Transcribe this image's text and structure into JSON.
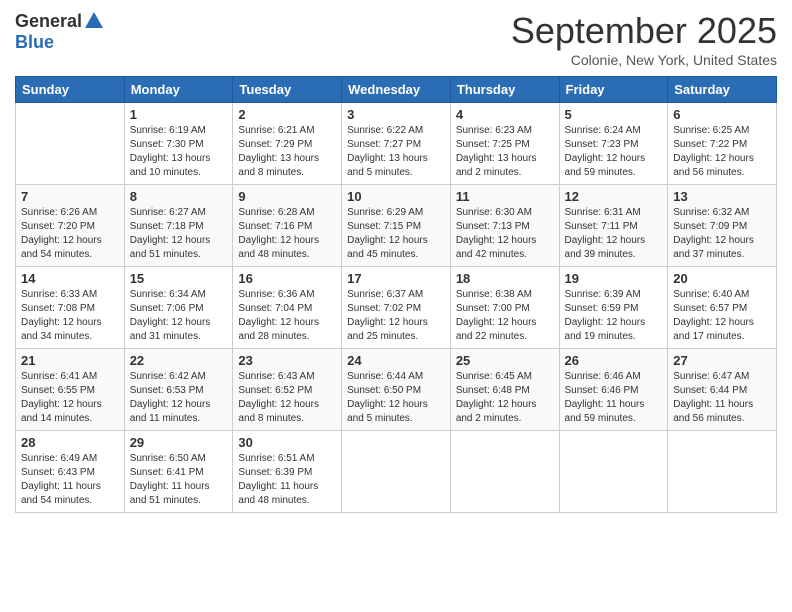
{
  "logo": {
    "general": "General",
    "blue": "Blue"
  },
  "header": {
    "month": "September 2025",
    "location": "Colonie, New York, United States"
  },
  "weekdays": [
    "Sunday",
    "Monday",
    "Tuesday",
    "Wednesday",
    "Thursday",
    "Friday",
    "Saturday"
  ],
  "weeks": [
    [
      {
        "day": null,
        "sunrise": null,
        "sunset": null,
        "daylight": null
      },
      {
        "day": "1",
        "sunrise": "Sunrise: 6:19 AM",
        "sunset": "Sunset: 7:30 PM",
        "daylight": "Daylight: 13 hours and 10 minutes."
      },
      {
        "day": "2",
        "sunrise": "Sunrise: 6:21 AM",
        "sunset": "Sunset: 7:29 PM",
        "daylight": "Daylight: 13 hours and 8 minutes."
      },
      {
        "day": "3",
        "sunrise": "Sunrise: 6:22 AM",
        "sunset": "Sunset: 7:27 PM",
        "daylight": "Daylight: 13 hours and 5 minutes."
      },
      {
        "day": "4",
        "sunrise": "Sunrise: 6:23 AM",
        "sunset": "Sunset: 7:25 PM",
        "daylight": "Daylight: 13 hours and 2 minutes."
      },
      {
        "day": "5",
        "sunrise": "Sunrise: 6:24 AM",
        "sunset": "Sunset: 7:23 PM",
        "daylight": "Daylight: 12 hours and 59 minutes."
      },
      {
        "day": "6",
        "sunrise": "Sunrise: 6:25 AM",
        "sunset": "Sunset: 7:22 PM",
        "daylight": "Daylight: 12 hours and 56 minutes."
      }
    ],
    [
      {
        "day": "7",
        "sunrise": "Sunrise: 6:26 AM",
        "sunset": "Sunset: 7:20 PM",
        "daylight": "Daylight: 12 hours and 54 minutes."
      },
      {
        "day": "8",
        "sunrise": "Sunrise: 6:27 AM",
        "sunset": "Sunset: 7:18 PM",
        "daylight": "Daylight: 12 hours and 51 minutes."
      },
      {
        "day": "9",
        "sunrise": "Sunrise: 6:28 AM",
        "sunset": "Sunset: 7:16 PM",
        "daylight": "Daylight: 12 hours and 48 minutes."
      },
      {
        "day": "10",
        "sunrise": "Sunrise: 6:29 AM",
        "sunset": "Sunset: 7:15 PM",
        "daylight": "Daylight: 12 hours and 45 minutes."
      },
      {
        "day": "11",
        "sunrise": "Sunrise: 6:30 AM",
        "sunset": "Sunset: 7:13 PM",
        "daylight": "Daylight: 12 hours and 42 minutes."
      },
      {
        "day": "12",
        "sunrise": "Sunrise: 6:31 AM",
        "sunset": "Sunset: 7:11 PM",
        "daylight": "Daylight: 12 hours and 39 minutes."
      },
      {
        "day": "13",
        "sunrise": "Sunrise: 6:32 AM",
        "sunset": "Sunset: 7:09 PM",
        "daylight": "Daylight: 12 hours and 37 minutes."
      }
    ],
    [
      {
        "day": "14",
        "sunrise": "Sunrise: 6:33 AM",
        "sunset": "Sunset: 7:08 PM",
        "daylight": "Daylight: 12 hours and 34 minutes."
      },
      {
        "day": "15",
        "sunrise": "Sunrise: 6:34 AM",
        "sunset": "Sunset: 7:06 PM",
        "daylight": "Daylight: 12 hours and 31 minutes."
      },
      {
        "day": "16",
        "sunrise": "Sunrise: 6:36 AM",
        "sunset": "Sunset: 7:04 PM",
        "daylight": "Daylight: 12 hours and 28 minutes."
      },
      {
        "day": "17",
        "sunrise": "Sunrise: 6:37 AM",
        "sunset": "Sunset: 7:02 PM",
        "daylight": "Daylight: 12 hours and 25 minutes."
      },
      {
        "day": "18",
        "sunrise": "Sunrise: 6:38 AM",
        "sunset": "Sunset: 7:00 PM",
        "daylight": "Daylight: 12 hours and 22 minutes."
      },
      {
        "day": "19",
        "sunrise": "Sunrise: 6:39 AM",
        "sunset": "Sunset: 6:59 PM",
        "daylight": "Daylight: 12 hours and 19 minutes."
      },
      {
        "day": "20",
        "sunrise": "Sunrise: 6:40 AM",
        "sunset": "Sunset: 6:57 PM",
        "daylight": "Daylight: 12 hours and 17 minutes."
      }
    ],
    [
      {
        "day": "21",
        "sunrise": "Sunrise: 6:41 AM",
        "sunset": "Sunset: 6:55 PM",
        "daylight": "Daylight: 12 hours and 14 minutes."
      },
      {
        "day": "22",
        "sunrise": "Sunrise: 6:42 AM",
        "sunset": "Sunset: 6:53 PM",
        "daylight": "Daylight: 12 hours and 11 minutes."
      },
      {
        "day": "23",
        "sunrise": "Sunrise: 6:43 AM",
        "sunset": "Sunset: 6:52 PM",
        "daylight": "Daylight: 12 hours and 8 minutes."
      },
      {
        "day": "24",
        "sunrise": "Sunrise: 6:44 AM",
        "sunset": "Sunset: 6:50 PM",
        "daylight": "Daylight: 12 hours and 5 minutes."
      },
      {
        "day": "25",
        "sunrise": "Sunrise: 6:45 AM",
        "sunset": "Sunset: 6:48 PM",
        "daylight": "Daylight: 12 hours and 2 minutes."
      },
      {
        "day": "26",
        "sunrise": "Sunrise: 6:46 AM",
        "sunset": "Sunset: 6:46 PM",
        "daylight": "Daylight: 11 hours and 59 minutes."
      },
      {
        "day": "27",
        "sunrise": "Sunrise: 6:47 AM",
        "sunset": "Sunset: 6:44 PM",
        "daylight": "Daylight: 11 hours and 56 minutes."
      }
    ],
    [
      {
        "day": "28",
        "sunrise": "Sunrise: 6:49 AM",
        "sunset": "Sunset: 6:43 PM",
        "daylight": "Daylight: 11 hours and 54 minutes."
      },
      {
        "day": "29",
        "sunrise": "Sunrise: 6:50 AM",
        "sunset": "Sunset: 6:41 PM",
        "daylight": "Daylight: 11 hours and 51 minutes."
      },
      {
        "day": "30",
        "sunrise": "Sunrise: 6:51 AM",
        "sunset": "Sunset: 6:39 PM",
        "daylight": "Daylight: 11 hours and 48 minutes."
      },
      {
        "day": null,
        "sunrise": null,
        "sunset": null,
        "daylight": null
      },
      {
        "day": null,
        "sunrise": null,
        "sunset": null,
        "daylight": null
      },
      {
        "day": null,
        "sunrise": null,
        "sunset": null,
        "daylight": null
      },
      {
        "day": null,
        "sunrise": null,
        "sunset": null,
        "daylight": null
      }
    ]
  ]
}
